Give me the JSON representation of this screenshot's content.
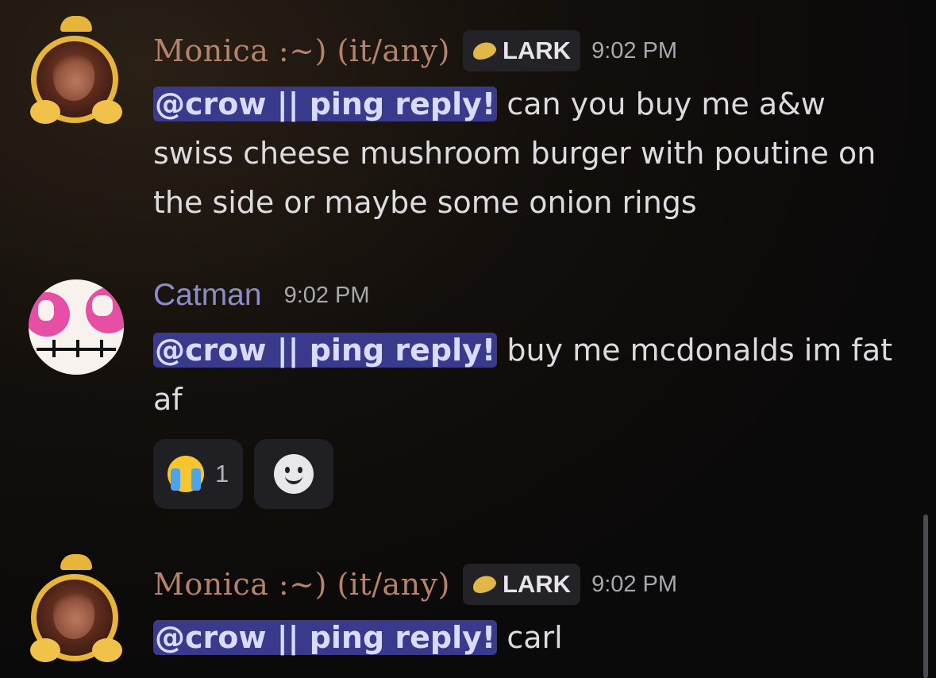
{
  "messages": [
    {
      "author": "Monica :~) (it/any)",
      "tag": "LARK",
      "time": "9:02 PM",
      "mention": "@crow || ping reply!",
      "text": " can you buy me a&w swiss cheese mushroom burger with poutine on the side or maybe some onion rings"
    },
    {
      "author": "Catman",
      "time": "9:02 PM",
      "mention": "@crow || ping reply!",
      "text": " buy me mcdonalds im fat af",
      "reactions": [
        {
          "emoji": "loudly-crying-face",
          "count": "1"
        }
      ]
    },
    {
      "author": "Monica :~) (it/any)",
      "tag": "LARK",
      "time": "9:02 PM",
      "mention": "@crow || ping reply!",
      "text": " carl"
    }
  ],
  "colors": {
    "monica_name": "#b7826a",
    "catman_name": "#8c8cc8",
    "mention_bg": "#3a3a8c",
    "tag_icon": "#e0b84a"
  }
}
